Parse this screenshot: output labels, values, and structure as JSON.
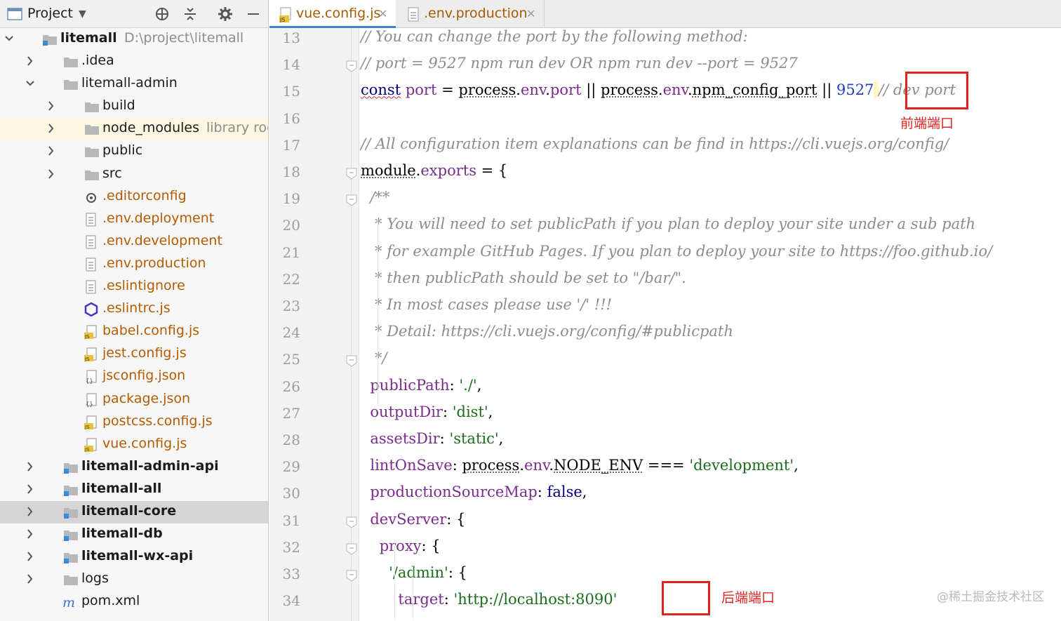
{
  "panel": {
    "title": "Project",
    "actions": [
      "target-icon",
      "collapse-icon",
      "gear-icon",
      "minimize-icon"
    ]
  },
  "tree": [
    {
      "label": "litemall",
      "hint": "D:\\project\\litemall",
      "indent": 0,
      "expanded": true,
      "bold": true,
      "kind": "module"
    },
    {
      "label": ".idea",
      "indent": 1,
      "expanded": false,
      "kind": "folder"
    },
    {
      "label": "litemall-admin",
      "indent": 1,
      "expanded": true,
      "kind": "folder"
    },
    {
      "label": "build",
      "indent": 2,
      "expanded": false,
      "kind": "folder"
    },
    {
      "label": "node_modules",
      "hint": "library root",
      "indent": 2,
      "expanded": false,
      "kind": "folder",
      "highlight": true
    },
    {
      "label": "public",
      "indent": 2,
      "expanded": false,
      "kind": "folder"
    },
    {
      "label": "src",
      "indent": 2,
      "expanded": false,
      "kind": "folder"
    },
    {
      "label": ".editorconfig",
      "indent": 2,
      "kind": "config",
      "orange": true
    },
    {
      "label": ".env.deployment",
      "indent": 2,
      "kind": "text",
      "orange": true
    },
    {
      "label": ".env.development",
      "indent": 2,
      "kind": "text",
      "orange": true
    },
    {
      "label": ".env.production",
      "indent": 2,
      "kind": "text",
      "orange": true
    },
    {
      "label": ".eslintignore",
      "indent": 2,
      "kind": "text",
      "orange": true
    },
    {
      "label": ".eslintrc.js",
      "indent": 2,
      "kind": "eslint",
      "orange": true
    },
    {
      "label": "babel.config.js",
      "indent": 2,
      "kind": "js",
      "orange": true
    },
    {
      "label": "jest.config.js",
      "indent": 2,
      "kind": "js",
      "orange": true
    },
    {
      "label": "jsconfig.json",
      "indent": 2,
      "kind": "json",
      "orange": true
    },
    {
      "label": "package.json",
      "indent": 2,
      "kind": "json",
      "orange": true
    },
    {
      "label": "postcss.config.js",
      "indent": 2,
      "kind": "js",
      "orange": true
    },
    {
      "label": "vue.config.js",
      "indent": 2,
      "kind": "js",
      "orange": true
    },
    {
      "label": "litemall-admin-api",
      "indent": 1,
      "expanded": false,
      "bold": true,
      "kind": "module"
    },
    {
      "label": "litemall-all",
      "indent": 1,
      "expanded": false,
      "bold": true,
      "kind": "module"
    },
    {
      "label": "litemall-core",
      "indent": 1,
      "expanded": false,
      "bold": true,
      "kind": "module",
      "selected": true
    },
    {
      "label": "litemall-db",
      "indent": 1,
      "expanded": false,
      "bold": true,
      "kind": "module"
    },
    {
      "label": "litemall-wx-api",
      "indent": 1,
      "expanded": false,
      "bold": true,
      "kind": "module"
    },
    {
      "label": "logs",
      "indent": 1,
      "expanded": false,
      "kind": "folder"
    },
    {
      "label": "pom.xml",
      "indent": 1,
      "kind": "maven"
    }
  ],
  "tabs": [
    {
      "label": "vue.config.js",
      "active": true,
      "kind": "js"
    },
    {
      "label": ".env.production",
      "active": false,
      "kind": "text"
    }
  ],
  "editor": {
    "line_numbers": [
      "13",
      "14",
      "15",
      "16",
      "17",
      "18",
      "19",
      "20",
      "21",
      "22",
      "23",
      "24",
      "25",
      "26",
      "27",
      "28",
      "29",
      "30",
      "31",
      "32",
      "33",
      "34"
    ],
    "lines": [
      [
        {
          "t": "// You can change the port by the following method:",
          "c": "cm"
        }
      ],
      [
        {
          "t": "// port = 9527 npm run dev OR npm run dev --port = 9527",
          "c": "cm"
        }
      ],
      [
        {
          "t": "const",
          "c": "kw"
        },
        {
          "t": " "
        },
        {
          "t": "port",
          "c": "fld"
        },
        {
          "t": " = "
        },
        {
          "t": "process",
          "c": "under"
        },
        {
          "t": "."
        },
        {
          "t": "env",
          "c": "fld"
        },
        {
          "t": "."
        },
        {
          "t": "port",
          "c": "fld"
        },
        {
          "t": " || "
        },
        {
          "t": "process",
          "c": "under"
        },
        {
          "t": "."
        },
        {
          "t": "env",
          "c": "fld"
        },
        {
          "t": "."
        },
        {
          "t": "npm_config_port",
          "c": "under"
        },
        {
          "t": " || "
        },
        {
          "t": "9527",
          "c": "num"
        },
        {
          "t": " ",
          "c": "caretmark"
        },
        {
          "t": "// dev port",
          "c": "cm"
        }
      ],
      [],
      [
        {
          "t": "// All configuration item explanations can be find in https://cli.vuejs.org/config/",
          "c": "cm"
        }
      ],
      [
        {
          "t": "module",
          "c": "under"
        },
        {
          "t": "."
        },
        {
          "t": "exports",
          "c": "fld"
        },
        {
          "t": " = {"
        }
      ],
      [
        {
          "t": "  /**",
          "c": "cm"
        }
      ],
      [
        {
          "t": "   * You will need to set publicPath if you plan to deploy your site under a sub path",
          "c": "cm"
        }
      ],
      [
        {
          "t": "   * for example GitHub Pages. If you plan to deploy your site to https://foo.github.io/",
          "c": "cm"
        }
      ],
      [
        {
          "t": "   * then publicPath should be set to \"/bar/\".",
          "c": "cm"
        }
      ],
      [
        {
          "t": "   * In most cases please use '/' !!!",
          "c": "cm"
        }
      ],
      [
        {
          "t": "   * Detail: https://cli.vuejs.org/config/#publicpath",
          "c": "cm"
        }
      ],
      [
        {
          "t": "   */",
          "c": "cm"
        }
      ],
      [
        {
          "t": "  "
        },
        {
          "t": "publicPath",
          "c": "fld"
        },
        {
          "t": ": "
        },
        {
          "t": "'./'",
          "c": "str"
        },
        {
          "t": ","
        }
      ],
      [
        {
          "t": "  "
        },
        {
          "t": "outputDir",
          "c": "fld"
        },
        {
          "t": ": "
        },
        {
          "t": "'dist'",
          "c": "str"
        },
        {
          "t": ","
        }
      ],
      [
        {
          "t": "  "
        },
        {
          "t": "assetsDir",
          "c": "fld"
        },
        {
          "t": ": "
        },
        {
          "t": "'static'",
          "c": "str"
        },
        {
          "t": ","
        }
      ],
      [
        {
          "t": "  "
        },
        {
          "t": "lintOnSave",
          "c": "fld"
        },
        {
          "t": ": "
        },
        {
          "t": "process",
          "c": "under"
        },
        {
          "t": "."
        },
        {
          "t": "env",
          "c": "fld"
        },
        {
          "t": "."
        },
        {
          "t": "NODE_ENV",
          "c": "under"
        },
        {
          "t": " === "
        },
        {
          "t": "'development'",
          "c": "str"
        },
        {
          "t": ","
        }
      ],
      [
        {
          "t": "  "
        },
        {
          "t": "productionSourceMap",
          "c": "fld"
        },
        {
          "t": ": "
        },
        {
          "t": "false",
          "c": "bool"
        },
        {
          "t": ","
        }
      ],
      [
        {
          "t": "  "
        },
        {
          "t": "devServer",
          "c": "fld"
        },
        {
          "t": ": {"
        }
      ],
      [
        {
          "t": "    "
        },
        {
          "t": "proxy",
          "c": "fld"
        },
        {
          "t": ": {"
        }
      ],
      [
        {
          "t": "      "
        },
        {
          "t": "'/admin'",
          "c": "str"
        },
        {
          "t": ": {"
        }
      ],
      [
        {
          "t": "        "
        },
        {
          "t": "target",
          "c": "fld"
        },
        {
          "t": ": "
        },
        {
          "t": "'http://localhost:8090'",
          "c": "str"
        }
      ]
    ],
    "fold_lines": [
      1,
      5,
      6,
      12,
      18,
      19,
      20
    ]
  },
  "annotations": {
    "frontend_port": "前端端口",
    "backend_port": "后端端口"
  },
  "watermark": "@稀土掘金技术社区",
  "colors": {
    "accent": "#4083c9",
    "annotation_red": "#e0231f",
    "selected_row": "#d5d5d5"
  }
}
